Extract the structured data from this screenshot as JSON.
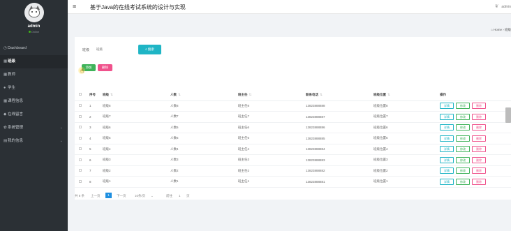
{
  "app": {
    "title": "基于Java的在线考试系统的设计与实现",
    "menu_icon": "≡",
    "header_user": "admin"
  },
  "profile": {
    "name": "admin",
    "status": "Online"
  },
  "sidebar": {
    "items": [
      {
        "label": "Dashboard",
        "icon": "dashboard-icon",
        "glyph": "◷"
      },
      {
        "label": "班级",
        "icon": "grid-icon",
        "glyph": "▦"
      },
      {
        "label": "教师",
        "icon": "grid-icon",
        "glyph": "▦"
      },
      {
        "label": "学生",
        "icon": "user-icon",
        "glyph": "●"
      },
      {
        "label": "课程信息",
        "icon": "grid-icon",
        "glyph": "▦"
      },
      {
        "label": "在线留言",
        "icon": "message-icon",
        "glyph": "◆"
      },
      {
        "label": "系统管理",
        "icon": "gear-icon",
        "glyph": "✿",
        "arrow": "⌄"
      },
      {
        "label": "我的信息",
        "icon": "card-icon",
        "glyph": "▤",
        "arrow": "⌄"
      }
    ]
  },
  "breadcrumb": {
    "home": "Home",
    "sep": "›",
    "current": "班级"
  },
  "search": {
    "label": "班级",
    "placeholder": "班级",
    "button": "搜索"
  },
  "actions": {
    "add": "添加",
    "delete": "删除"
  },
  "table": {
    "headers": {
      "index": "序号",
      "banji": "班级",
      "renshu": "人数",
      "banzhuren": "班主任",
      "lianxi": "联系电话",
      "weizhi": "班级位置",
      "ops": "操作"
    },
    "sort_glyph": "⇅",
    "op_labels": {
      "detail": "详情",
      "edit": "修改",
      "remove": "删除"
    },
    "rows": [
      {
        "idx": "1",
        "banji": "班级8",
        "renshu": "人数8",
        "banzhuren": "班主任8",
        "lianxi": "13823888888",
        "weizhi": "班级位置8"
      },
      {
        "idx": "2",
        "banji": "班级7",
        "renshu": "人数7",
        "banzhuren": "班主任7",
        "lianxi": "13823888887",
        "weizhi": "班级位置7"
      },
      {
        "idx": "3",
        "banji": "班级6",
        "renshu": "人数6",
        "banzhuren": "班主任6",
        "lianxi": "13823888886",
        "weizhi": "班级位置6"
      },
      {
        "idx": "4",
        "banji": "班级5",
        "renshu": "人数5",
        "banzhuren": "班主任5",
        "lianxi": "13823888885",
        "weizhi": "班级位置5"
      },
      {
        "idx": "5",
        "banji": "班级4",
        "renshu": "人数4",
        "banzhuren": "班主任4",
        "lianxi": "13823888884",
        "weizhi": "班级位置4"
      },
      {
        "idx": "6",
        "banji": "班级3",
        "renshu": "人数3",
        "banzhuren": "班主任3",
        "lianxi": "13823888883",
        "weizhi": "班级位置3"
      },
      {
        "idx": "7",
        "banji": "班级2",
        "renshu": "人数2",
        "banzhuren": "班主任2",
        "lianxi": "13823888882",
        "weizhi": "班级位置2"
      },
      {
        "idx": "8",
        "banji": "班级1",
        "renshu": "人数1",
        "banzhuren": "班主任1",
        "lianxi": "13823888881",
        "weizhi": "班级位置1"
      }
    ]
  },
  "pagination": {
    "total": "共 8 条",
    "prev": "上一页",
    "current": "1",
    "next": "下一页",
    "page_size": "10条/页",
    "goto_label": "前往",
    "goto_value": "1",
    "page_suffix": "页"
  }
}
